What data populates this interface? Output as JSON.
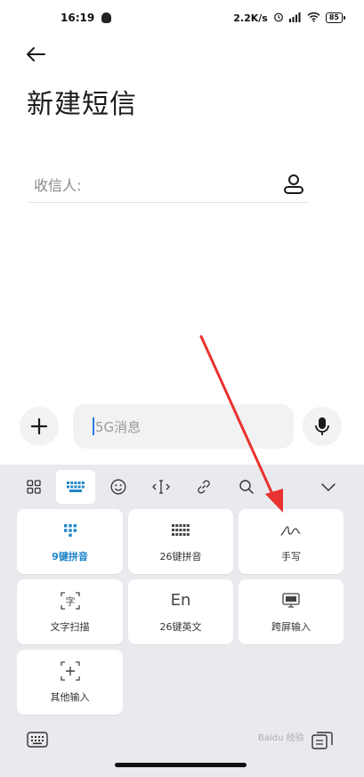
{
  "status_bar": {
    "time": "16:19",
    "net_speed": "2.2K/s",
    "battery": "85"
  },
  "header": {
    "title": "新建短信"
  },
  "recipient": {
    "label": "收信人:"
  },
  "compose": {
    "placeholder": "5G消息"
  },
  "keyboard": {
    "toolbar": [
      "grid-icon",
      "numpad-icon",
      "emoji-icon",
      "cursor-icon",
      "link-icon",
      "search-icon",
      "chevron-down-icon"
    ],
    "keys": [
      {
        "label": "9键拼音",
        "icon": "nine-key-icon",
        "selected": true
      },
      {
        "label": "26键拼音",
        "icon": "twenty-six-key-icon"
      },
      {
        "label": "手写",
        "icon": "handwriting-icon"
      },
      {
        "label": "文字扫描",
        "icon": "text-scan-icon",
        "glyph": "字"
      },
      {
        "label": "26键英文",
        "icon": "english-key-icon",
        "glyph": "En"
      },
      {
        "label": "跨屏输入",
        "icon": "cross-screen-icon"
      },
      {
        "label": "其他输入",
        "icon": "other-input-icon"
      }
    ]
  },
  "colors": {
    "accent": "#1f86c9",
    "annotation": "#e8322f",
    "keyboard_bg": "#e9eaee"
  }
}
